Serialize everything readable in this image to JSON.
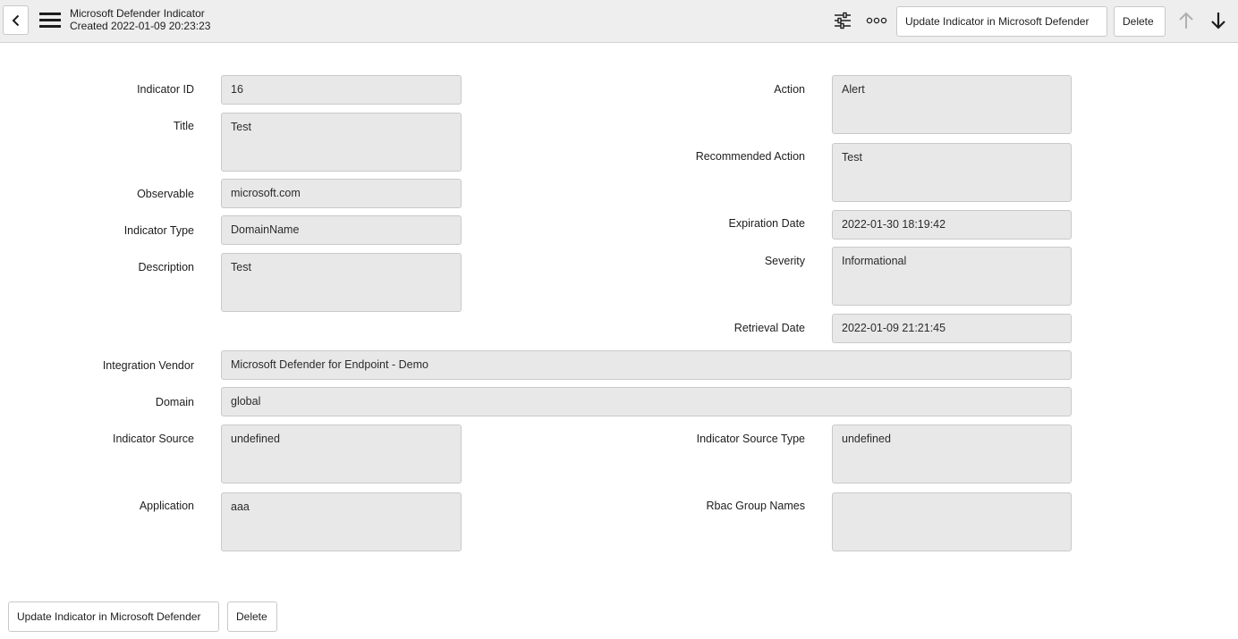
{
  "header": {
    "title": "Microsoft Defender Indicator",
    "created": "Created 2022-01-09 20:23:23",
    "update_label": "Update Indicator in Microsoft Defender",
    "delete_label": "Delete",
    "more_label": "ooo"
  },
  "fields": {
    "indicator_id": {
      "label": "Indicator ID",
      "value": "16"
    },
    "title": {
      "label": "Title",
      "value": "Test"
    },
    "observable": {
      "label": "Observable",
      "value": "microsoft.com"
    },
    "indicator_type": {
      "label": "Indicator Type",
      "value": "DomainName"
    },
    "description": {
      "label": "Description",
      "value": "Test"
    },
    "action": {
      "label": "Action",
      "value": "Alert"
    },
    "recommended_action": {
      "label": "Recommended Action",
      "value": "Test"
    },
    "expiration_date": {
      "label": "Expiration Date",
      "value": "2022-01-30 18:19:42"
    },
    "severity": {
      "label": "Severity",
      "value": "Informational"
    },
    "retrieval_date": {
      "label": "Retrieval Date",
      "value": "2022-01-09 21:21:45"
    },
    "integration_vendor": {
      "label": "Integration Vendor",
      "value": "Microsoft Defender for Endpoint - Demo"
    },
    "domain": {
      "label": "Domain",
      "value": "global"
    },
    "indicator_source": {
      "label": "Indicator Source",
      "value": "undefined"
    },
    "indicator_source_type": {
      "label": "Indicator Source Type",
      "value": "undefined"
    },
    "application": {
      "label": "Application",
      "value": "aaa"
    },
    "rbac_group_names": {
      "label": "Rbac Group Names",
      "value": ""
    }
  },
  "footer": {
    "update_label": "Update Indicator in Microsoft Defender",
    "delete_label": "Delete"
  },
  "colors": {
    "header_bg": "#eeeeee",
    "field_bg": "#e8e8e8",
    "border": "#c9c9c9",
    "disabled_arrow": "#b0b0b0"
  }
}
